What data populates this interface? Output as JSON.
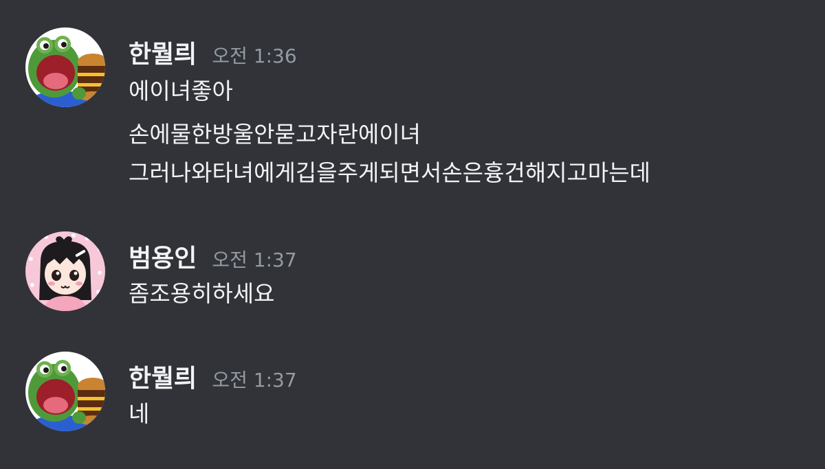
{
  "colors": {
    "background": "#313338",
    "username": "#f2f3f5",
    "timestamp": "#949ba4",
    "message_text": "#f2f3f5"
  },
  "messages": [
    {
      "avatar_icon": "pepe-frog-burger-avatar",
      "username": "한뭘릐",
      "timestamp": "오전 1:36",
      "lines": [
        "에이녀좋아",
        "손에물한방울안묻고자란에이녀",
        "그러나와타녀에게깁을주게되면서손은흉건해지고마는데"
      ]
    },
    {
      "avatar_icon": "anime-girl-avatar",
      "username": "범용인",
      "timestamp": "오전 1:37",
      "lines": [
        "좀조용히하세요"
      ]
    },
    {
      "avatar_icon": "pepe-frog-burger-avatar",
      "username": "한뭘릐",
      "timestamp": "오전 1:37",
      "lines": [
        "네"
      ]
    }
  ]
}
